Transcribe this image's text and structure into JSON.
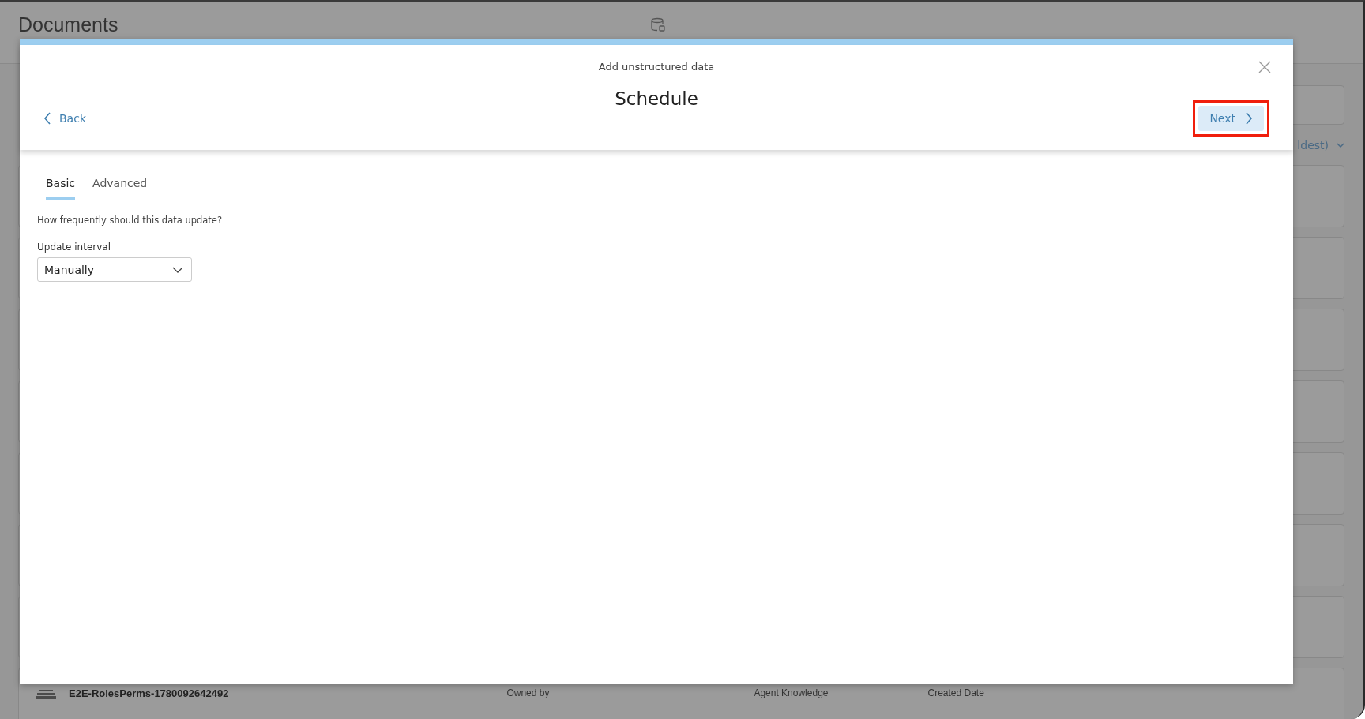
{
  "page": {
    "title": "Documents",
    "sort_label": "ldest)",
    "rows": [
      {
        "name": "E2E-RolesPerms-1780092642492",
        "owner_label": "Owned by",
        "type": "Agent Knowledge",
        "date_label": "Created Date"
      }
    ]
  },
  "dialog": {
    "subtitle": "Add unstructured data",
    "title": "Schedule",
    "back": "Back",
    "next": "Next",
    "next_highlighted": true,
    "tabs": [
      {
        "label": "Basic",
        "selected": true
      },
      {
        "label": "Advanced",
        "selected": false
      }
    ],
    "question": "How frequently should this data update?",
    "field": {
      "label": "Update interval",
      "value": "Manually"
    }
  }
}
